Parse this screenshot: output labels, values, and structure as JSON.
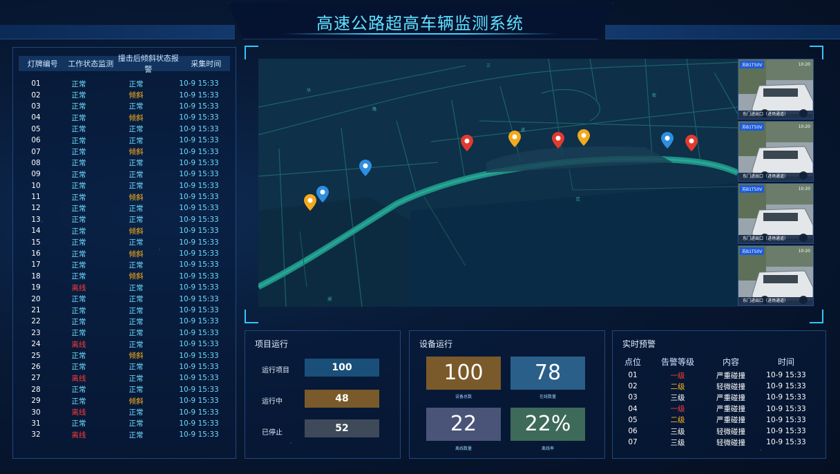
{
  "title": "高速公路超高车辆监测系统",
  "left_table": {
    "headers": [
      "灯牌编号",
      "工作状态监测",
      "撞击后倾斜状态报警",
      "采集时间"
    ],
    "rows": [
      {
        "id": "01",
        "work": "正常",
        "tilt": "正常",
        "time": "10-9 15:33"
      },
      {
        "id": "02",
        "work": "正常",
        "tilt": "倾斜",
        "time": "10-9 15:33"
      },
      {
        "id": "03",
        "work": "正常",
        "tilt": "正常",
        "time": "10-9 15:33"
      },
      {
        "id": "04",
        "work": "正常",
        "tilt": "倾斜",
        "time": "10-9 15:33"
      },
      {
        "id": "05",
        "work": "正常",
        "tilt": "正常",
        "time": "10-9 15:33"
      },
      {
        "id": "06",
        "work": "正常",
        "tilt": "正常",
        "time": "10-9 15:33"
      },
      {
        "id": "07",
        "work": "正常",
        "tilt": "倾斜",
        "time": "10-9 15:33"
      },
      {
        "id": "08",
        "work": "正常",
        "tilt": "正常",
        "time": "10-9 15:33"
      },
      {
        "id": "09",
        "work": "正常",
        "tilt": "正常",
        "time": "10-9 15:33"
      },
      {
        "id": "10",
        "work": "正常",
        "tilt": "正常",
        "time": "10-9 15:33"
      },
      {
        "id": "11",
        "work": "正常",
        "tilt": "倾斜",
        "time": "10-9 15:33"
      },
      {
        "id": "12",
        "work": "正常",
        "tilt": "正常",
        "time": "10-9 15:33"
      },
      {
        "id": "13",
        "work": "正常",
        "tilt": "正常",
        "time": "10-9 15:33"
      },
      {
        "id": "14",
        "work": "正常",
        "tilt": "倾斜",
        "time": "10-9 15:33"
      },
      {
        "id": "15",
        "work": "正常",
        "tilt": "正常",
        "time": "10-9 15:33"
      },
      {
        "id": "16",
        "work": "正常",
        "tilt": "倾斜",
        "time": "10-9 15:33"
      },
      {
        "id": "17",
        "work": "正常",
        "tilt": "正常",
        "time": "10-9 15:33"
      },
      {
        "id": "18",
        "work": "正常",
        "tilt": "倾斜",
        "time": "10-9 15:33"
      },
      {
        "id": "19",
        "work": "离线",
        "tilt": "正常",
        "time": "10-9 15:33"
      },
      {
        "id": "20",
        "work": "正常",
        "tilt": "正常",
        "time": "10-9 15:33"
      },
      {
        "id": "21",
        "work": "正常",
        "tilt": "正常",
        "time": "10-9 15:33"
      },
      {
        "id": "22",
        "work": "正常",
        "tilt": "正常",
        "time": "10-9 15:33"
      },
      {
        "id": "23",
        "work": "正常",
        "tilt": "正常",
        "time": "10-9 15:33"
      },
      {
        "id": "24",
        "work": "离线",
        "tilt": "正常",
        "time": "10-9 15:33"
      },
      {
        "id": "25",
        "work": "正常",
        "tilt": "倾斜",
        "time": "10-9 15:33"
      },
      {
        "id": "26",
        "work": "正常",
        "tilt": "正常",
        "time": "10-9 15:33"
      },
      {
        "id": "27",
        "work": "离线",
        "tilt": "正常",
        "time": "10-9 15:33"
      },
      {
        "id": "28",
        "work": "正常",
        "tilt": "正常",
        "time": "10-9 15:33"
      },
      {
        "id": "29",
        "work": "正常",
        "tilt": "倾斜",
        "time": "10-9 15:33"
      },
      {
        "id": "30",
        "work": "离线",
        "tilt": "正常",
        "time": "10-9 15:33"
      },
      {
        "id": "31",
        "work": "正常",
        "tilt": "正常",
        "time": "10-9 15:33"
      },
      {
        "id": "32",
        "work": "离线",
        "tilt": "正常",
        "time": "10-9 15:33"
      }
    ]
  },
  "map": {
    "markers": [
      {
        "color": "red"
      },
      {
        "color": "orange"
      },
      {
        "color": "red"
      },
      {
        "color": "orange"
      },
      {
        "color": "blue"
      },
      {
        "color": "red"
      },
      {
        "color": "blue"
      },
      {
        "color": "blue"
      },
      {
        "color": "orange"
      }
    ],
    "cameras": [
      {
        "tag": "苏B1T50V",
        "time": "10:20",
        "caption": "东门进出口（进场通道）"
      },
      {
        "tag": "苏B1T50V",
        "time": "10:20",
        "caption": "东门进出口（进场通道）"
      },
      {
        "tag": "苏B1T50V",
        "time": "10:20",
        "caption": "东门进出口（进场通道）"
      },
      {
        "tag": "苏B1T50V",
        "time": "10:20",
        "caption": "东门进出口（进场通道）"
      }
    ]
  },
  "project": {
    "title": "项目运行",
    "items": [
      {
        "label": "运行项目",
        "value": "100",
        "color": "#1a4f7a"
      },
      {
        "label": "运行中",
        "value": "48",
        "color": "#7a5a2a"
      },
      {
        "label": "已停止",
        "value": "52",
        "color": "#3e4a5a"
      }
    ]
  },
  "device": {
    "title": "设备运行",
    "items": [
      {
        "label": "设备总数",
        "value": "100",
        "color": "#7a5a2a"
      },
      {
        "label": "在线数量",
        "value": "78",
        "color": "#2a5f8a"
      },
      {
        "label": "离线数量",
        "value": "22",
        "color": "#4a5478"
      },
      {
        "label": "离线率",
        "value": "22%",
        "color": "#3e6a5a"
      }
    ]
  },
  "alerts": {
    "title": "实时预警",
    "headers": [
      "点位",
      "告警等级",
      "内容",
      "时间"
    ],
    "rows": [
      {
        "point": "01",
        "level": "一级",
        "content": "严重碰撞",
        "time": "10-9 15:33"
      },
      {
        "point": "02",
        "level": "二级",
        "content": "轻微碰撞",
        "time": "10-9 15:33"
      },
      {
        "point": "03",
        "level": "三级",
        "content": "严重碰撞",
        "time": "10-9 15:33"
      },
      {
        "point": "04",
        "level": "一级",
        "content": "严重碰撞",
        "time": "10-9 15:33"
      },
      {
        "point": "05",
        "level": "二级",
        "content": "严重碰撞",
        "time": "10-9 15:33"
      },
      {
        "point": "06",
        "level": "三级",
        "content": "轻微碰撞",
        "time": "10-9 15:33"
      },
      {
        "point": "07",
        "level": "三级",
        "content": "轻微碰撞",
        "time": "10-9 15:33"
      }
    ]
  },
  "colors": {
    "ok": "#6fdcff",
    "warn": "#ffb320",
    "err": "#ff3b3b",
    "accent": "#5fe3ff"
  }
}
